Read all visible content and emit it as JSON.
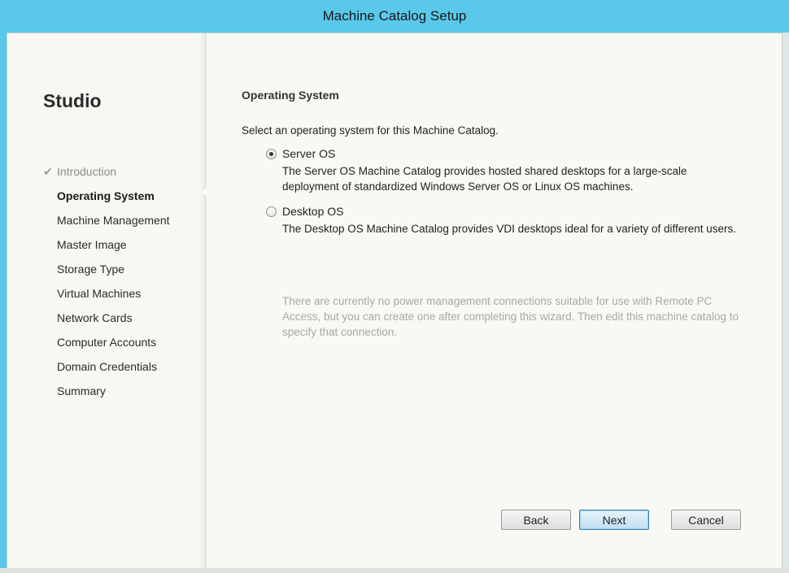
{
  "window": {
    "title": "Machine Catalog Setup"
  },
  "sidebar": {
    "brand": "Studio",
    "steps": [
      {
        "label": "Introduction",
        "state": "done"
      },
      {
        "label": "Operating System",
        "state": "current"
      },
      {
        "label": "Machine Management",
        "state": "pending"
      },
      {
        "label": "Master Image",
        "state": "pending"
      },
      {
        "label": "Storage Type",
        "state": "pending"
      },
      {
        "label": "Virtual Machines",
        "state": "pending"
      },
      {
        "label": "Network Cards",
        "state": "pending"
      },
      {
        "label": "Computer Accounts",
        "state": "pending"
      },
      {
        "label": "Domain Credentials",
        "state": "pending"
      },
      {
        "label": "Summary",
        "state": "pending"
      }
    ]
  },
  "main": {
    "heading": "Operating System",
    "prompt": "Select an operating system for this Machine Catalog.",
    "options": [
      {
        "label": "Server OS",
        "description": "The Server OS Machine Catalog provides hosted shared desktops for a large-scale deployment of standardized Windows Server OS or Linux OS machines.",
        "selected": true
      },
      {
        "label": "Desktop OS",
        "description": "The Desktop OS Machine Catalog provides VDI desktops ideal for a variety of different users.",
        "selected": false
      }
    ],
    "note": "There are currently no power management connections suitable for use with Remote PC Access, but you can create one after completing this wizard. Then edit this machine catalog to specify that connection."
  },
  "footer": {
    "back_label": "Back",
    "next_label": "Next",
    "cancel_label": "Cancel"
  },
  "colors": {
    "titlebar": "#5ac8ea",
    "background": "#f7f8f3",
    "primary_button_border": "#3c7fb1"
  },
  "icons": {
    "completed_step": "checkmark-icon"
  }
}
